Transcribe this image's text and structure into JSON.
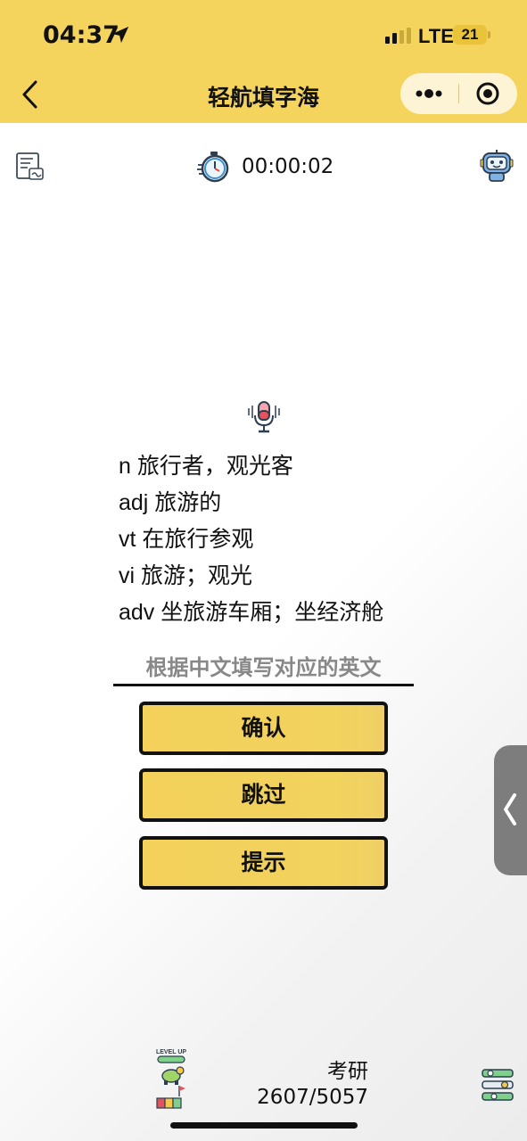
{
  "status_bar": {
    "time": "04:37",
    "network": "LTE",
    "battery": "21"
  },
  "nav": {
    "title": "轻航填字海"
  },
  "toolbar": {
    "timer": "00:00:02"
  },
  "word": {
    "definitions": [
      "n 旅行者，观光客",
      "adj 旅游的",
      "vt 在旅行参观",
      "vi 旅游；观光",
      "adv 坐旅游车厢；坐经济舱"
    ]
  },
  "answer": {
    "placeholder": "根据中文填写对应的英文",
    "value": ""
  },
  "buttons": {
    "confirm": "确认",
    "skip": "跳过",
    "hint": "提示"
  },
  "footer": {
    "level_label": "LEVEL UP",
    "category": "考研",
    "progress": "2607/5057"
  },
  "colors": {
    "brand_yellow": "#f5d45e",
    "button_yellow": "#f3d15a",
    "text_dark": "#111111",
    "side_tab_gray": "#7d7d7d"
  },
  "icons": {
    "back": "chevron-left-icon",
    "more": "more-dots-icon",
    "close": "target-close-icon",
    "note": "note-card-icon",
    "timer": "stopwatch-icon",
    "robot": "robot-icon",
    "mic": "microphone-icon",
    "level": "level-up-icon",
    "settings": "settings-sliders-icon",
    "side_tab": "chevron-left-icon"
  }
}
